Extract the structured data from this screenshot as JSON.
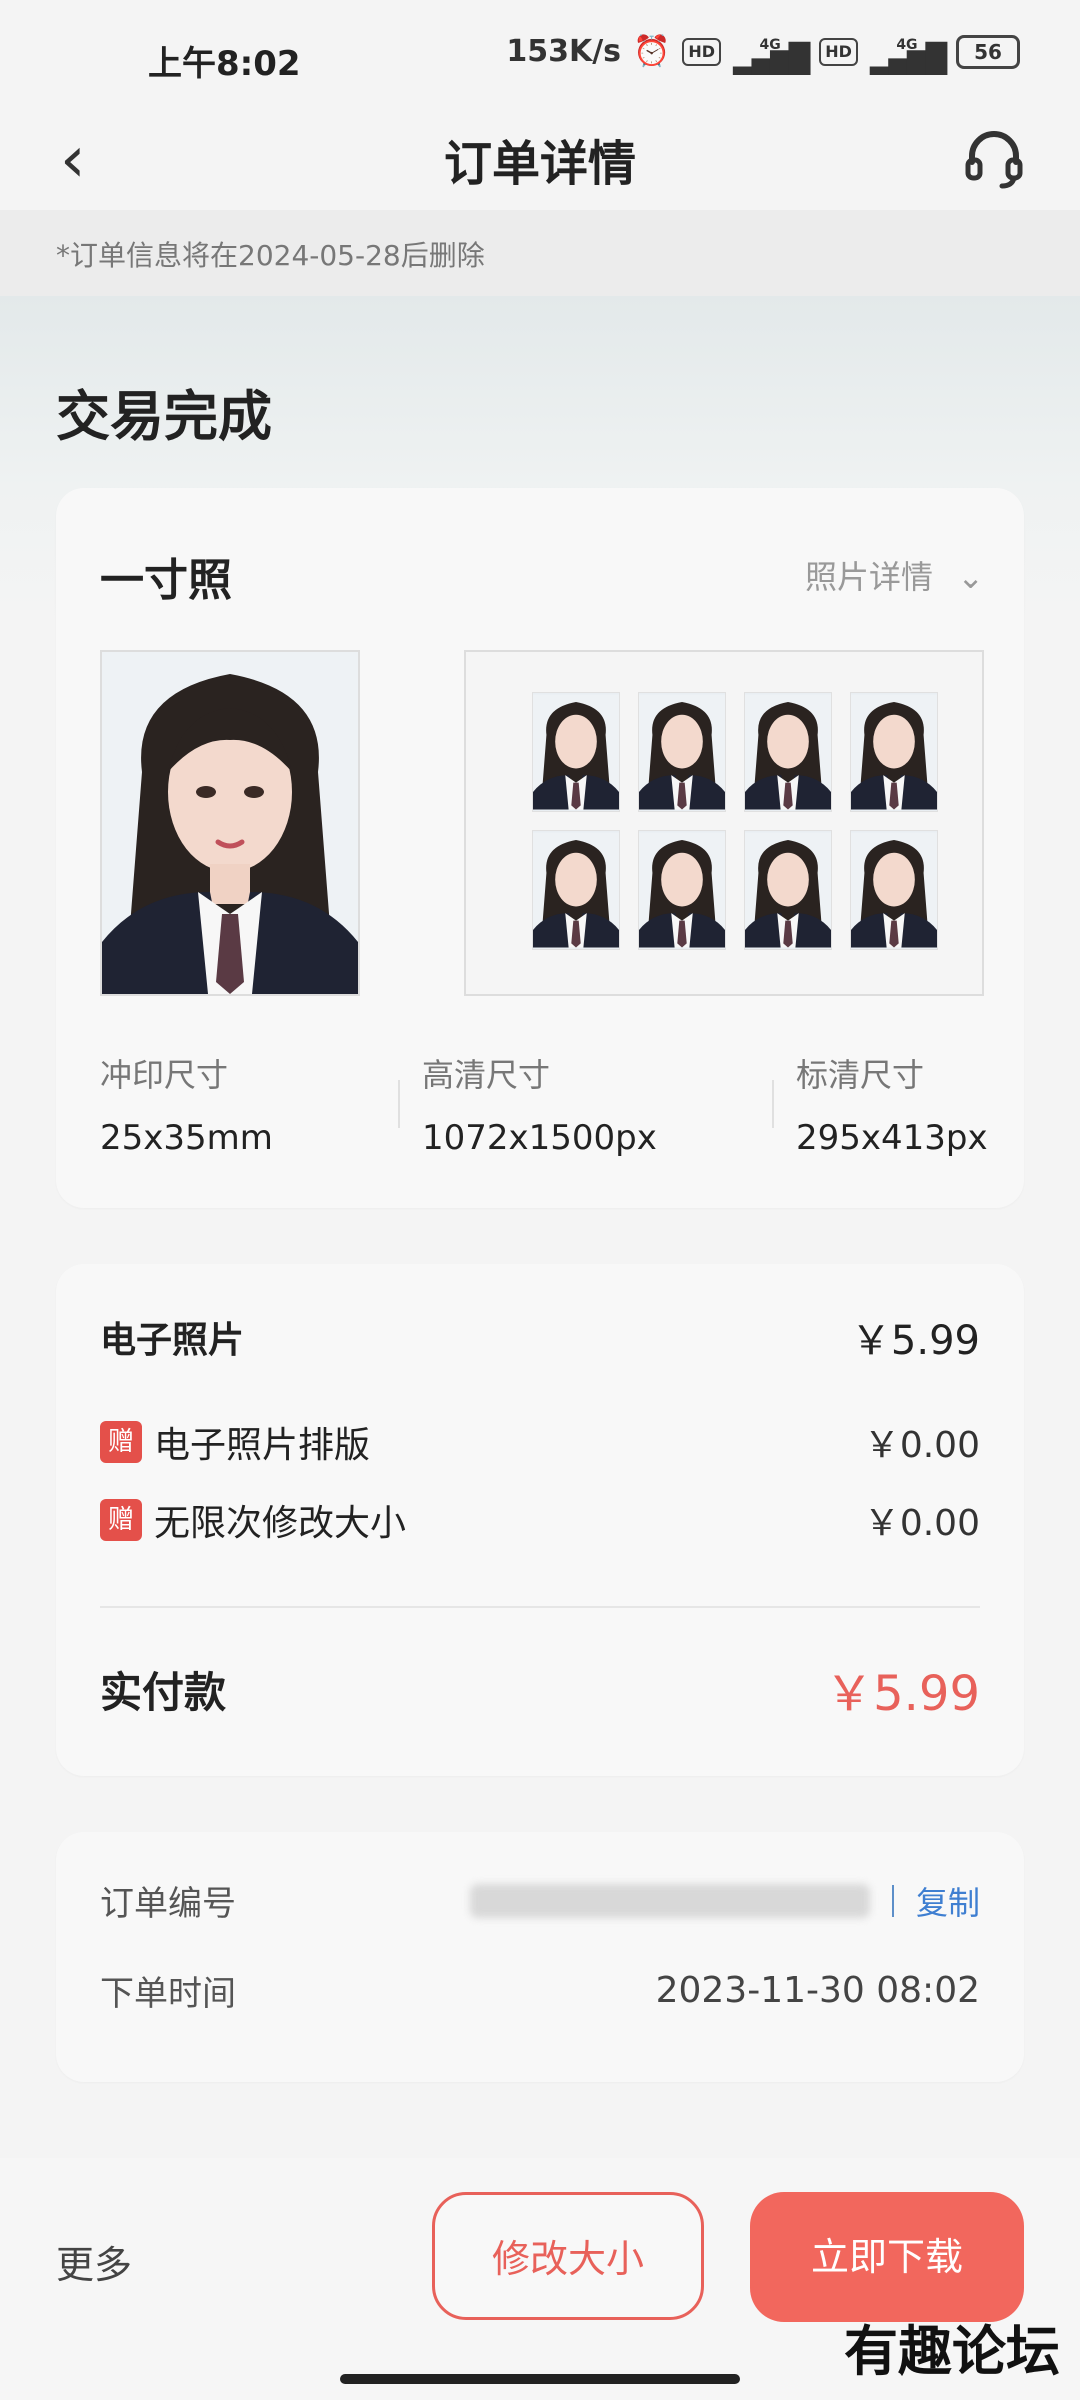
{
  "status_bar": {
    "time": "上午8:02",
    "speed": "153K/s",
    "hd1": "HD",
    "net1": "4G",
    "hd2": "HD",
    "net2": "4G",
    "battery": "56"
  },
  "nav": {
    "back_icon": "chevron-left",
    "title": "订单详情",
    "service_icon": "headset"
  },
  "notice": "*订单信息将在2024-05-28后删除",
  "order_status": "交易完成",
  "photo_card": {
    "title": "一寸照",
    "detail_label": "照片详情",
    "specs": [
      {
        "label": "冲印尺寸",
        "value": "25x35mm"
      },
      {
        "label": "高清尺寸",
        "value": "1072x1500px"
      },
      {
        "label": "标清尺寸",
        "value": "295x413px"
      }
    ]
  },
  "price_card": {
    "item": {
      "label": "电子照片",
      "price": "￥5.99"
    },
    "gifts": [
      {
        "badge": "赠",
        "label": "电子照片排版",
        "price": "￥0.00"
      },
      {
        "badge": "赠",
        "label": "无限次修改大小",
        "price": "￥0.00"
      }
    ],
    "paid": {
      "label": "实付款",
      "price": "￥5.99"
    }
  },
  "info_card": {
    "order_no_label": "订单编号",
    "copy_label": "复制",
    "time_label": "下单时间",
    "time_value": "2023-11-30 08:02"
  },
  "bottom": {
    "more": "更多",
    "resize": "修改大小",
    "download": "立即下载"
  },
  "watermark": "有趣论坛",
  "colors": {
    "accent": "#f2675d",
    "link": "#3f7fd1",
    "badge": "#e4504a"
  }
}
